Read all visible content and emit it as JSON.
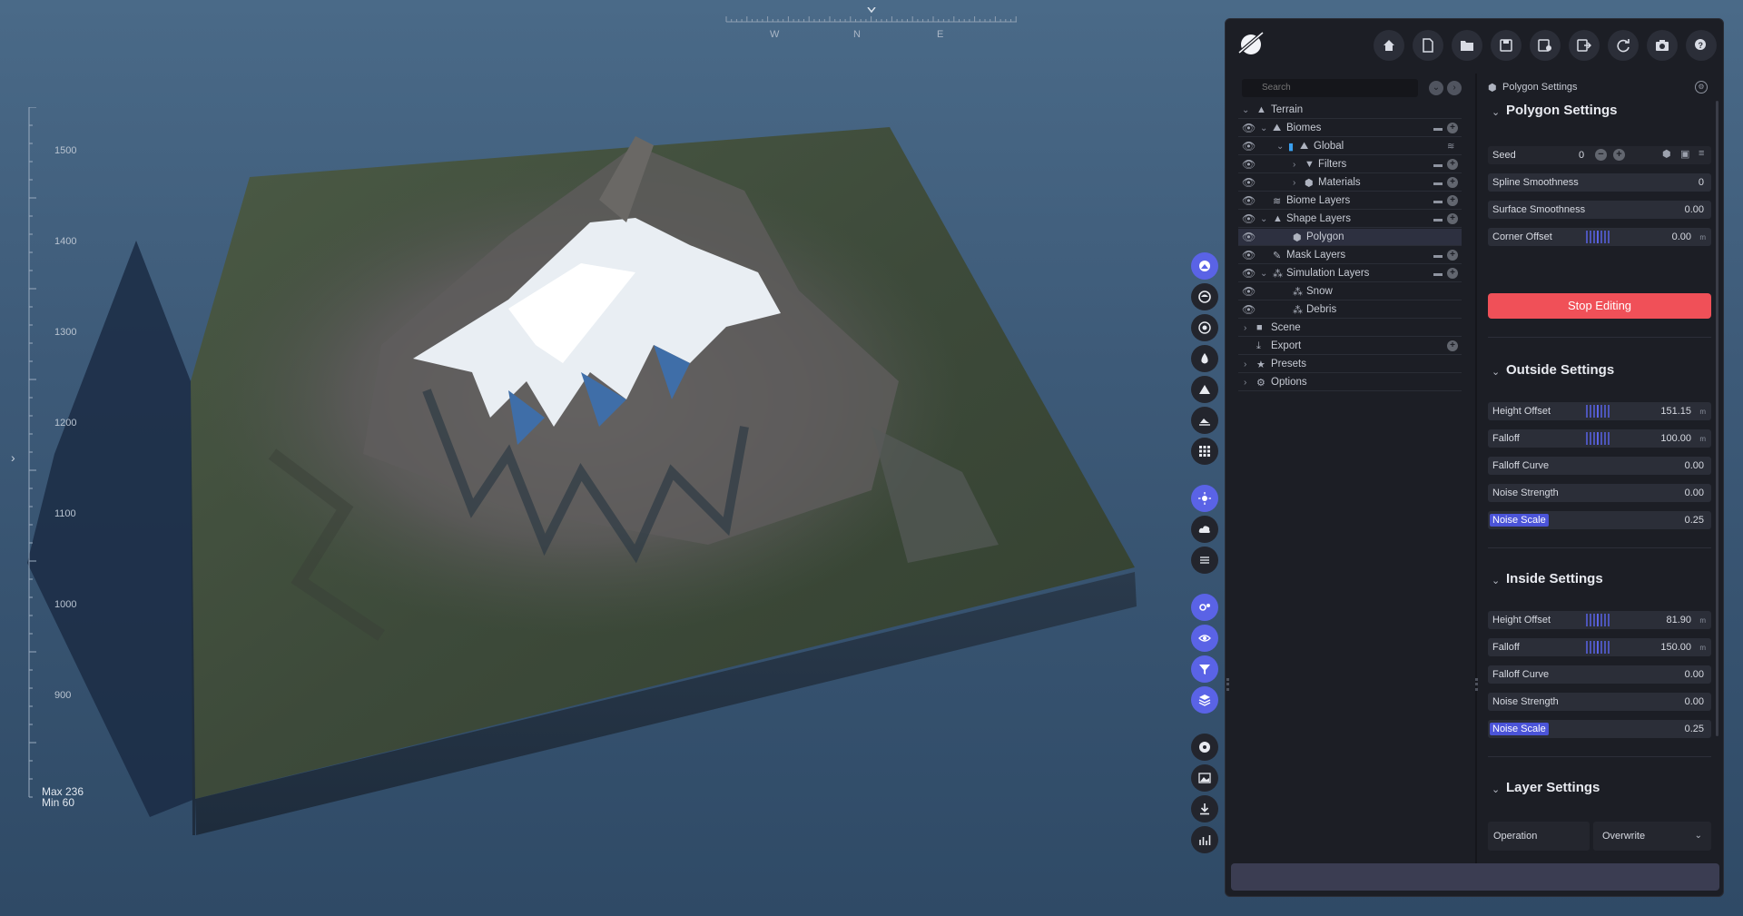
{
  "compass": {
    "letters": [
      "W",
      "N",
      "E"
    ]
  },
  "ruler": {
    "labels": [
      "1500",
      "1400",
      "1300",
      "1200",
      "1100",
      "1000",
      "900"
    ],
    "max_label": "Max 236",
    "min_label": "Min 60"
  },
  "colors": {
    "accent": "#5a63e6",
    "stop": "#f05058",
    "panel": "#1c1e25",
    "field": "#2b2e38"
  },
  "toolbar": {
    "icons": [
      "home-icon",
      "new-file-icon",
      "open-folder-icon",
      "save-icon",
      "save-as-icon",
      "export-file-icon",
      "refresh-icon",
      "camera-icon",
      "help-icon"
    ]
  },
  "vtoolbar": {
    "icons": [
      "terrain-view-icon",
      "globe-icon",
      "target-icon",
      "water-drop-icon",
      "mountain-icon",
      "landscape-icon",
      "grid-icon",
      "sun-icon",
      "cloud-icon",
      "layers-icon",
      "settings-cog-icon",
      "eye-icon",
      "filter-icon",
      "stack-icon",
      "record-icon",
      "image-icon",
      "download-icon",
      "stats-icon"
    ]
  },
  "outliner": {
    "search_placeholder": "Search",
    "rows": [
      {
        "label": "Terrain"
      },
      {
        "label": "Biomes"
      },
      {
        "label": "Global"
      },
      {
        "label": "Filters"
      },
      {
        "label": "Materials"
      },
      {
        "label": "Biome Layers"
      },
      {
        "label": "Shape Layers"
      },
      {
        "label": "Polygon"
      },
      {
        "label": "Mask Layers"
      },
      {
        "label": "Simulation Layers"
      },
      {
        "label": "Snow"
      },
      {
        "label": "Debris"
      },
      {
        "label": "Scene"
      },
      {
        "label": "Export"
      },
      {
        "label": "Presets"
      },
      {
        "label": "Options"
      }
    ]
  },
  "settings": {
    "header": "Polygon Settings",
    "polygon": {
      "title": "Polygon Settings",
      "seed_label": "Seed",
      "seed_value": "0",
      "spline_label": "Spline Smoothness",
      "spline_value": "0",
      "surface_label": "Surface Smoothness",
      "surface_value": "0.00",
      "corner_label": "Corner Offset",
      "corner_value": "0.00",
      "corner_unit": "m",
      "stop_label": "Stop Editing"
    },
    "outside": {
      "title": "Outside Settings",
      "height_label": "Height Offset",
      "height_value": "151.15",
      "height_unit": "m",
      "falloff_label": "Falloff",
      "falloff_value": "100.00",
      "falloff_unit": "m",
      "curve_label": "Falloff Curve",
      "curve_value": "0.00",
      "noise_strength_label": "Noise Strength",
      "noise_strength_value": "0.00",
      "noise_scale_label": "Noise Scale",
      "noise_scale_value": "0.25"
    },
    "inside": {
      "title": "Inside Settings",
      "height_label": "Height Offset",
      "height_value": "81.90",
      "height_unit": "m",
      "falloff_label": "Falloff",
      "falloff_value": "150.00",
      "falloff_unit": "m",
      "curve_label": "Falloff Curve",
      "curve_value": "0.00",
      "noise_strength_label": "Noise Strength",
      "noise_strength_value": "0.00",
      "noise_scale_label": "Noise Scale",
      "noise_scale_value": "0.25"
    },
    "layer": {
      "title": "Layer Settings",
      "operation_label": "Operation",
      "operation_value": "Overwrite"
    }
  }
}
